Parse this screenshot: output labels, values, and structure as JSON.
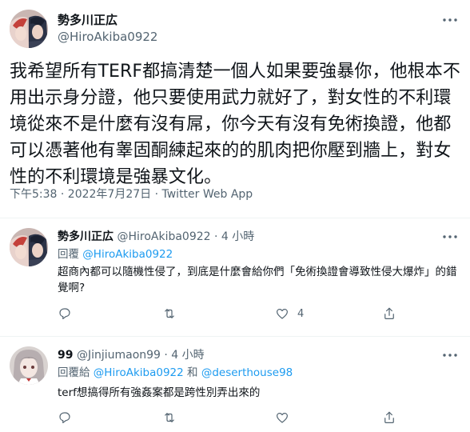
{
  "main_tweet": {
    "author_name": "勢多川正広",
    "author_handle": "@HiroAkiba0922",
    "text": "我希望所有TERF都搞清楚一個人如果要強暴你，他根本不用出示身分證，他只要使用武力就好了，對女性的不利環境從來不是什麼有沒有屌，你今天有沒有免術換證，他都可以憑著他有睾固酮練起來的的肌肉把你壓到牆上，對女性的不利環境是強暴文化。",
    "meta": "下午5:38 · 2022年7月27日 · Twitter Web App"
  },
  "replies": [
    {
      "author_name": "勢多川正広",
      "author_handle": "@HiroAkiba0922",
      "time": "· 4 小時",
      "reply_prefix": "回覆 ",
      "reply_to_1": "@HiroAkiba0922",
      "reply_and": "",
      "reply_to_2": "",
      "text": "超商內都可以隨機性侵了，到底是什麼會給你們「免術換證會導致性侵大爆炸」的錯覺啊?",
      "reply_count": "",
      "retweet_count": "",
      "like_count": "4"
    },
    {
      "author_name": "99",
      "author_handle": "@Jinjiumaon99",
      "time": "· 4 小時",
      "reply_prefix": "回覆給 ",
      "reply_to_1": "@HiroAkiba0922",
      "reply_and": " 和 ",
      "reply_to_2": "@deserthouse98",
      "text": "terf想搞得所有強姦案都是跨性別弄出來的",
      "reply_count": "",
      "retweet_count": "",
      "like_count": ""
    }
  ],
  "icons": {
    "more": "more-icon",
    "reply": "reply-icon",
    "retweet": "retweet-icon",
    "like": "like-icon",
    "share": "share-icon"
  },
  "colors": {
    "text": "#0f1419",
    "secondary": "#536471",
    "link": "#1d9bf0",
    "divider": "#eff3f4"
  }
}
